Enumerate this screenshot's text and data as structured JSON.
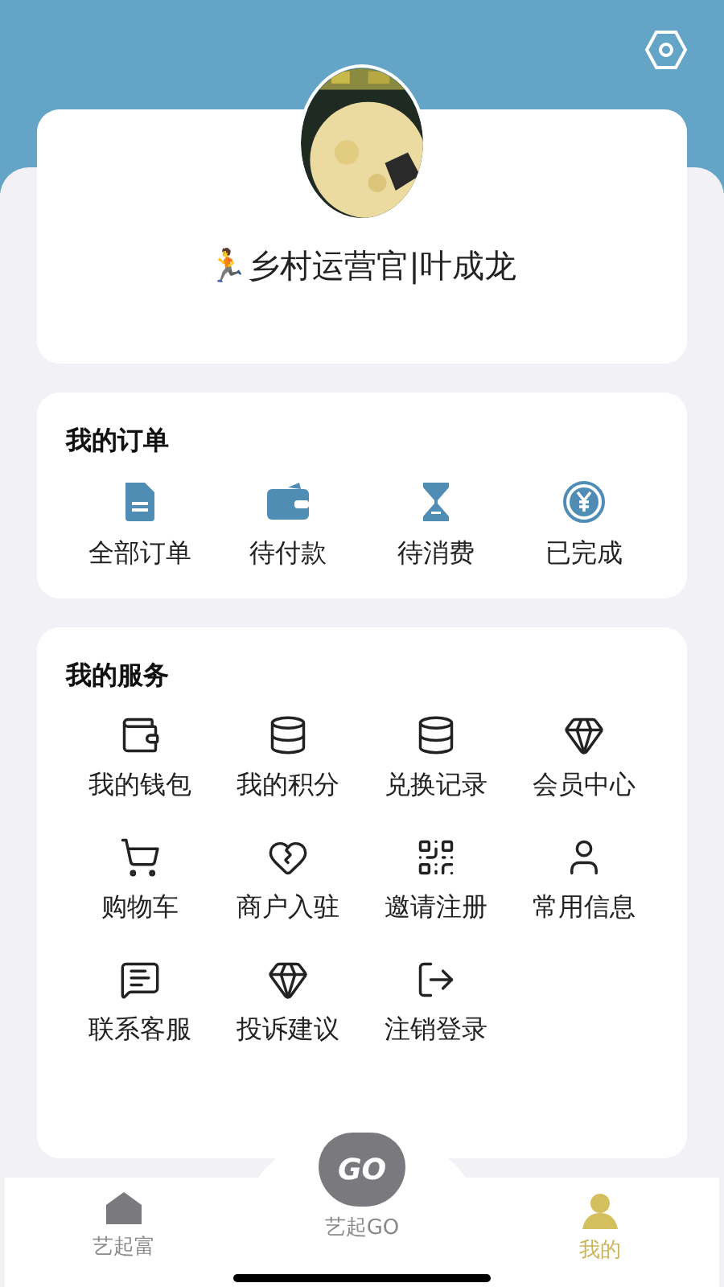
{
  "profile": {
    "name": "🏃乡村运营官|叶成龙"
  },
  "orders": {
    "title": "我的订单",
    "items": [
      {
        "label": "全部订单",
        "kind": "document"
      },
      {
        "label": "待付款",
        "kind": "wallet"
      },
      {
        "label": "待消费",
        "kind": "hourglass"
      },
      {
        "label": "已完成",
        "kind": "yen"
      }
    ]
  },
  "services": {
    "title": "我的服务",
    "items": [
      {
        "label": "我的钱包",
        "kind": "wallet"
      },
      {
        "label": "我的积分",
        "kind": "coins"
      },
      {
        "label": "兑换记录",
        "kind": "coins"
      },
      {
        "label": "会员中心",
        "kind": "gem"
      },
      {
        "label": "购物车",
        "kind": "cart"
      },
      {
        "label": "商户入驻",
        "kind": "heart"
      },
      {
        "label": "邀请注册",
        "kind": "qr"
      },
      {
        "label": "常用信息",
        "kind": "user"
      },
      {
        "label": "联系客服",
        "kind": "chat"
      },
      {
        "label": "投诉建议",
        "kind": "gem"
      },
      {
        "label": "注销登录",
        "kind": "logout"
      }
    ]
  },
  "tab_bar": [
    {
      "label": "艺起富",
      "kind": "home",
      "selected": false
    },
    {
      "label": "艺起GO",
      "kind": "center",
      "logo_text": "GO",
      "selected": false
    },
    {
      "label": "我的",
      "kind": "me",
      "selected": true
    }
  ]
}
